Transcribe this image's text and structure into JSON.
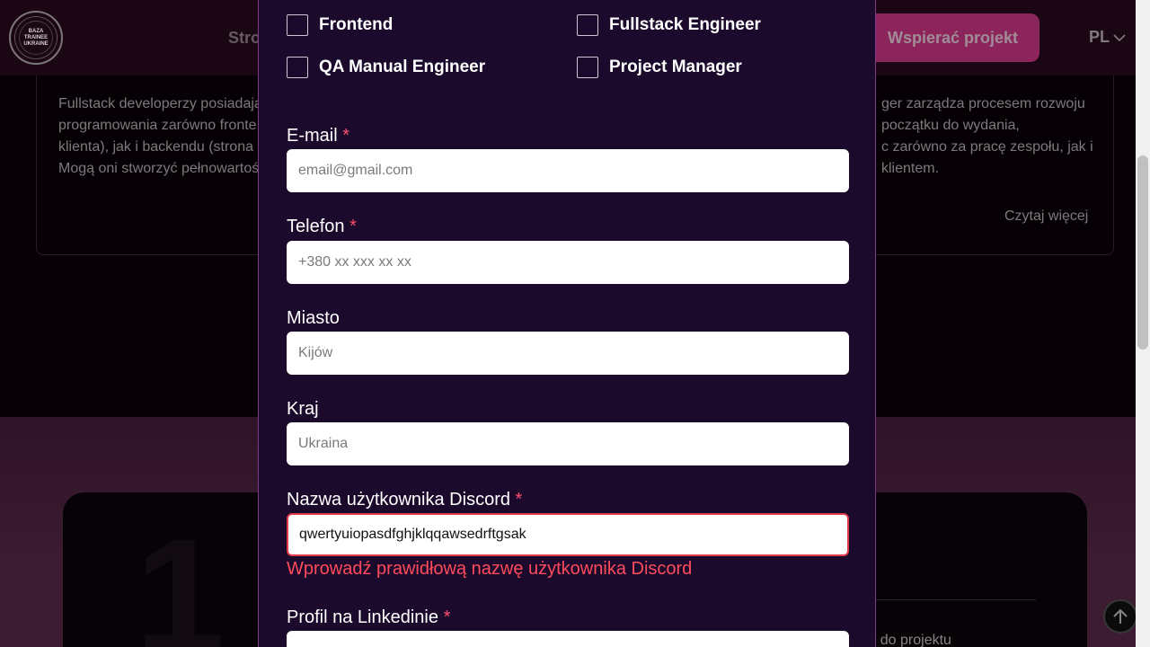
{
  "header": {
    "logo_text": "BAZA TRAINEE UKRAINE",
    "nav_partial": "Stro",
    "support_button": "Wspierać projekt",
    "language": "PL"
  },
  "cards": {
    "left_text": "Fullstack developerzy posiadają\nprogramowania zarówno fronte\nklienta), jak i backendu (strona\nMogą oni stworzyć pełnowartoś",
    "right_text": "ger zarządza procesem rozwoju\npoczątku do wydania,\nc zarówno za pracę zespołu, jak i\n klientem.",
    "read_more": "Czytaj więcej"
  },
  "bottom": {
    "big_number": "1",
    "to_project": "r do projektu"
  },
  "form": {
    "roles": [
      {
        "label": "Frontend"
      },
      {
        "label": "Fullstack Engineer"
      },
      {
        "label": "QA Manual Engineer"
      },
      {
        "label": "Project Manager"
      }
    ],
    "email": {
      "label": "E-mail",
      "required": "*",
      "placeholder": "email@gmail.com",
      "value": ""
    },
    "phone": {
      "label": "Telefon",
      "required": "*",
      "placeholder": "+380 xx xxx xx xx",
      "value": ""
    },
    "city": {
      "label": "Miasto",
      "placeholder": "Kijów",
      "value": ""
    },
    "country": {
      "label": "Kraj",
      "placeholder": "Ukraina",
      "value": ""
    },
    "discord": {
      "label": "Nazwa użytkownika Discord",
      "required": "*",
      "placeholder": "",
      "value": "qwertyuiopasdfghjklqqawsedrftgsak",
      "error": "Wprowadź prawidłową nazwę użytkownika Discord"
    },
    "linkedin": {
      "label": "Profil na Linkedinie",
      "required": "*",
      "placeholder": "",
      "value": ""
    }
  },
  "colors": {
    "modal_bg": "#1b0a2b",
    "accent_pink": "#d73a8c",
    "error_red": "#ff4b5c"
  }
}
